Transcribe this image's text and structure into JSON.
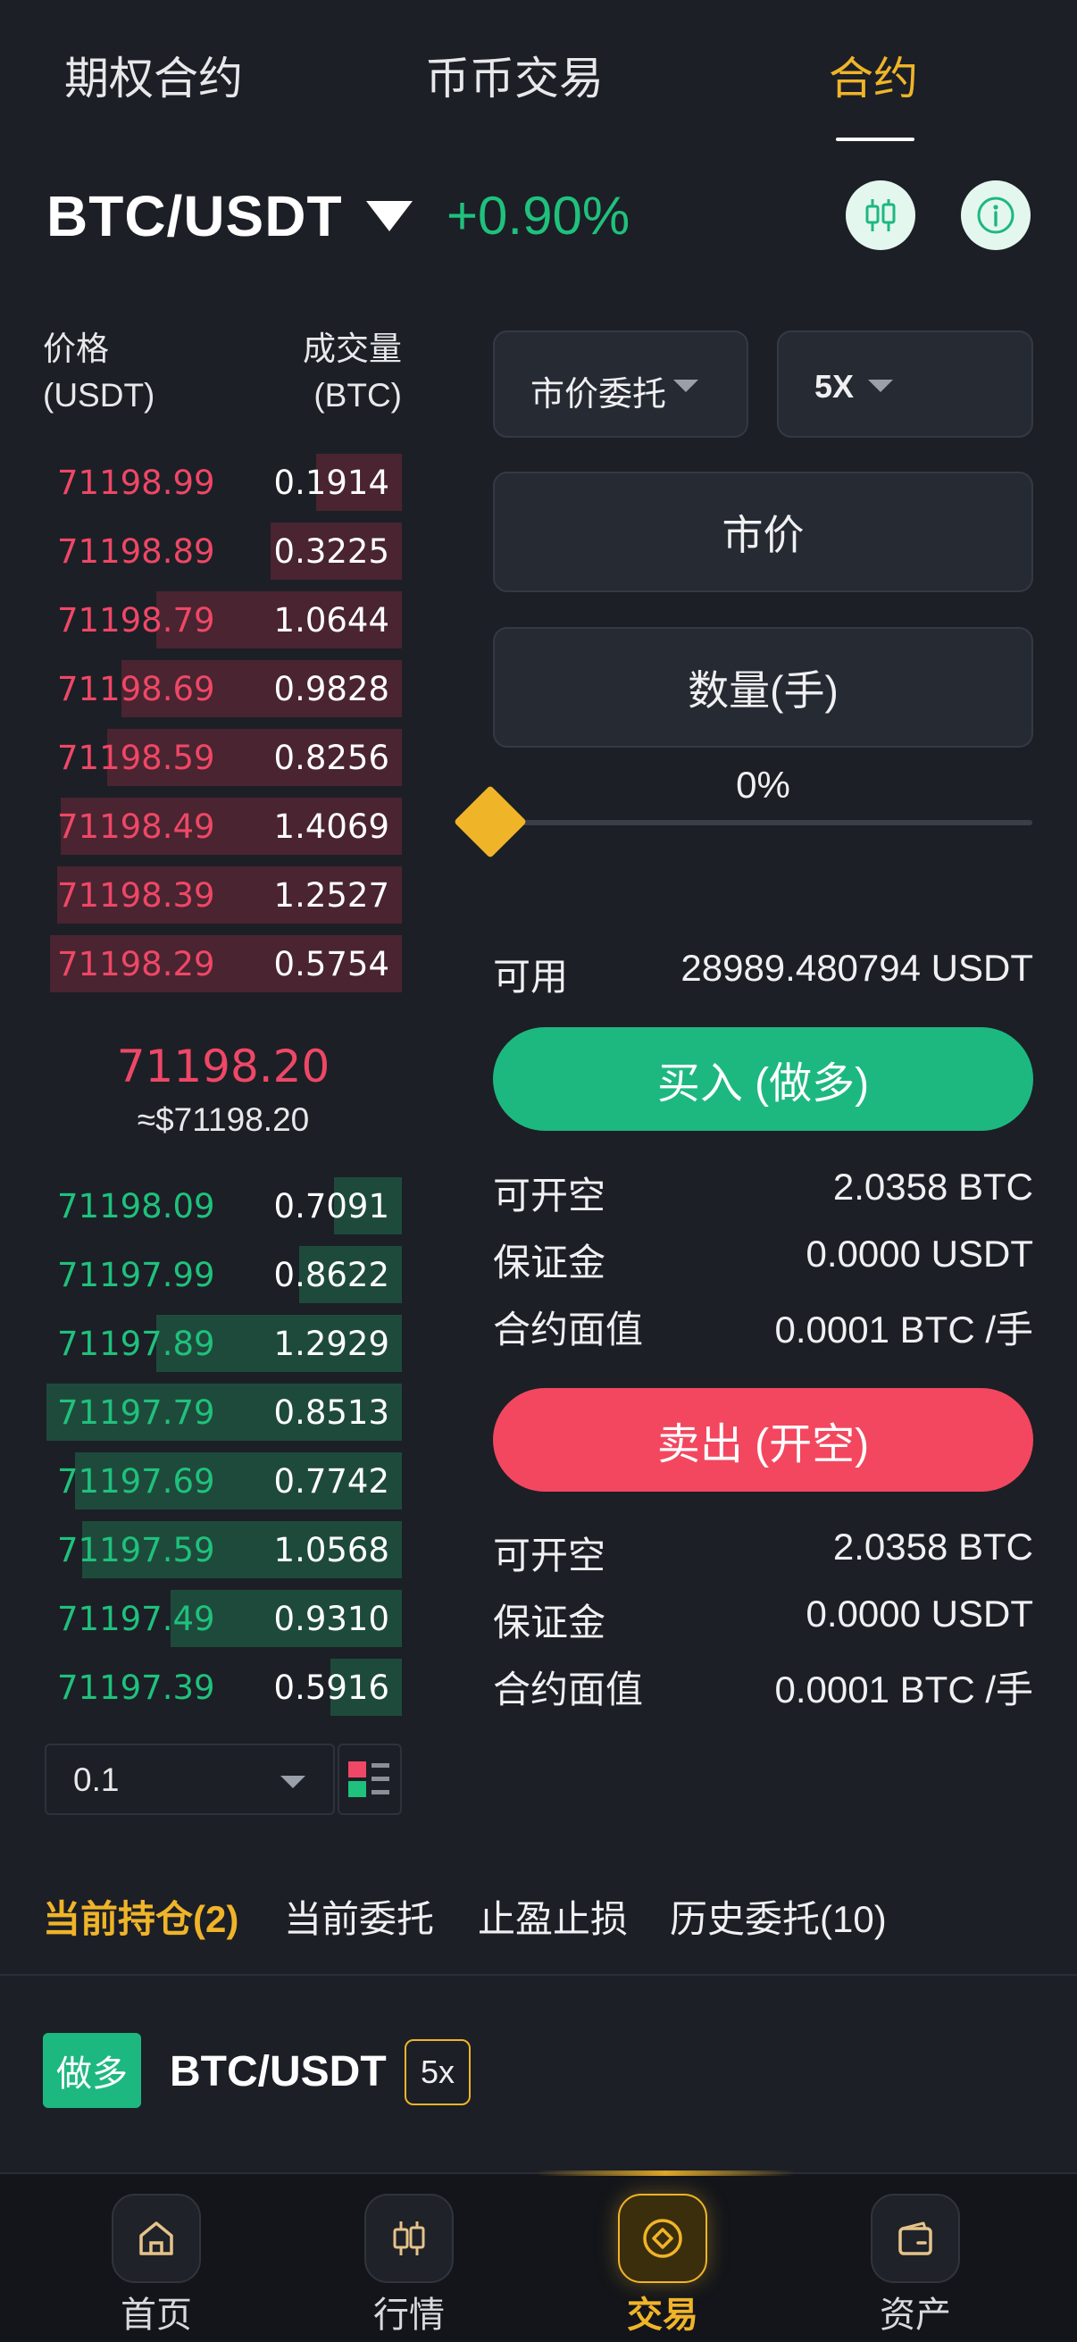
{
  "top_tabs": [
    "期权合约",
    "币币交易",
    "合约"
  ],
  "pair": {
    "symbol": "BTC/USDT",
    "change": "+0.90%"
  },
  "orderbook": {
    "price_header_1": "价格",
    "price_header_2": "(USDT)",
    "qty_header_1": "成交量",
    "qty_header_2": "(BTC)",
    "asks": [
      {
        "price": "71198.99",
        "qty": "0.1914",
        "depth": 0.24
      },
      {
        "price": "71198.89",
        "qty": "0.3225",
        "depth": 0.37
      },
      {
        "price": "71198.79",
        "qty": "1.0644",
        "depth": 0.69
      },
      {
        "price": "71198.69",
        "qty": "0.9828",
        "depth": 0.79
      },
      {
        "price": "71198.59",
        "qty": "0.8256",
        "depth": 0.83
      },
      {
        "price": "71198.49",
        "qty": "1.4069",
        "depth": 0.96
      },
      {
        "price": "71198.39",
        "qty": "1.2527",
        "depth": 0.97
      },
      {
        "price": "71198.29",
        "qty": "0.5754",
        "depth": 0.99
      }
    ],
    "mid_price": "71198.20",
    "mid_usd": "≈$71198.20",
    "bids": [
      {
        "price": "71198.09",
        "qty": "0.7091",
        "depth": 0.19
      },
      {
        "price": "71197.99",
        "qty": "0.8622",
        "depth": 0.29
      },
      {
        "price": "71197.89",
        "qty": "1.2929",
        "depth": 0.69
      },
      {
        "price": "71197.79",
        "qty": "0.8513",
        "depth": 1.0
      },
      {
        "price": "71197.69",
        "qty": "0.7742",
        "depth": 0.92
      },
      {
        "price": "71197.59",
        "qty": "1.0568",
        "depth": 0.9
      },
      {
        "price": "71197.49",
        "qty": "0.9310",
        "depth": 0.65
      },
      {
        "price": "71197.39",
        "qty": "0.5916",
        "depth": 0.2
      }
    ],
    "depth_step": "0.1"
  },
  "order_form": {
    "order_type": "市价委托",
    "leverage": "5X",
    "price_field": "市价",
    "qty_field": "数量(手)",
    "percent": "0%",
    "available_label": "可用",
    "available_value": "28989.480794 USDT",
    "buy_label": "买入 (做多)",
    "buy_info": [
      {
        "label": "可开空",
        "value": "2.0358 BTC"
      },
      {
        "label": "保证金",
        "value": "0.0000 USDT"
      },
      {
        "label": "合约面值",
        "value": "0.0001 BTC /手"
      }
    ],
    "sell_label": "卖出 (开空)",
    "sell_info": [
      {
        "label": "可开空",
        "value": "2.0358 BTC"
      },
      {
        "label": "保证金",
        "value": "0.0000 USDT"
      },
      {
        "label": "合约面值",
        "value": "0.0001 BTC /手"
      }
    ]
  },
  "position_tabs": [
    "当前持仓(2)",
    "当前委托",
    "止盈止损",
    "历史委托(10)"
  ],
  "position": {
    "side": "做多",
    "pair": "BTC/USDT",
    "leverage": "5x"
  },
  "bottom_nav": [
    "首页",
    "行情",
    "交易",
    "资产"
  ],
  "colors": {
    "up": "#1fc17c",
    "down": "#ef4766",
    "accent": "#f0b429",
    "bg": "#1c1f26"
  }
}
